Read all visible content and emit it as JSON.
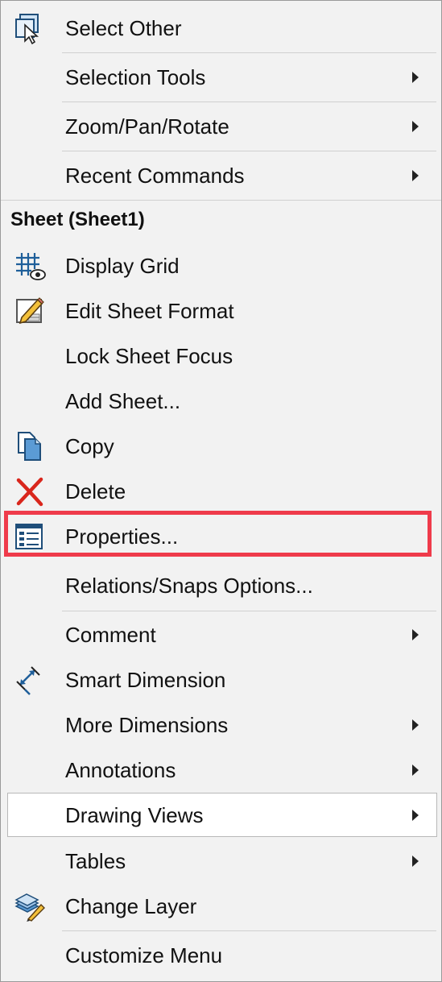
{
  "menu": {
    "items": [
      {
        "label": "Select Other",
        "icon": "select-other-icon",
        "submenu": false
      },
      {
        "label": "Selection Tools",
        "icon": "",
        "submenu": true
      },
      {
        "label": "Zoom/Pan/Rotate",
        "icon": "",
        "submenu": true
      },
      {
        "label": "Recent Commands",
        "icon": "",
        "submenu": true
      }
    ],
    "section_header": "Sheet (Sheet1)",
    "sheet_items": [
      {
        "label": "Display Grid",
        "icon": "display-grid-icon",
        "submenu": false
      },
      {
        "label": "Edit Sheet Format",
        "icon": "edit-sheet-format-icon",
        "submenu": false
      },
      {
        "label": "Lock Sheet Focus",
        "icon": "",
        "submenu": false
      },
      {
        "label": "Add Sheet...",
        "icon": "",
        "submenu": false
      },
      {
        "label": "Copy",
        "icon": "copy-icon",
        "submenu": false
      },
      {
        "label": "Delete",
        "icon": "delete-icon",
        "submenu": false
      },
      {
        "label": "Properties...",
        "icon": "properties-icon",
        "submenu": false,
        "highlighted": true
      },
      {
        "label": "Relations/Snaps Options...",
        "icon": "",
        "submenu": false
      },
      {
        "label": "Comment",
        "icon": "",
        "submenu": true
      },
      {
        "label": "Smart Dimension",
        "icon": "smart-dimension-icon",
        "submenu": false
      },
      {
        "label": "More Dimensions",
        "icon": "",
        "submenu": true
      },
      {
        "label": "Annotations",
        "icon": "",
        "submenu": true
      },
      {
        "label": "Drawing Views",
        "icon": "",
        "submenu": true,
        "hovered": true
      },
      {
        "label": "Tables",
        "icon": "",
        "submenu": true
      },
      {
        "label": "Change Layer",
        "icon": "change-layer-icon",
        "submenu": false
      },
      {
        "label": "Customize Menu",
        "icon": "",
        "submenu": false
      }
    ]
  },
  "colors": {
    "highlight_border": "#ef3b4b",
    "menu_background": "#f2f2f2",
    "hover_background": "#ffffff"
  }
}
